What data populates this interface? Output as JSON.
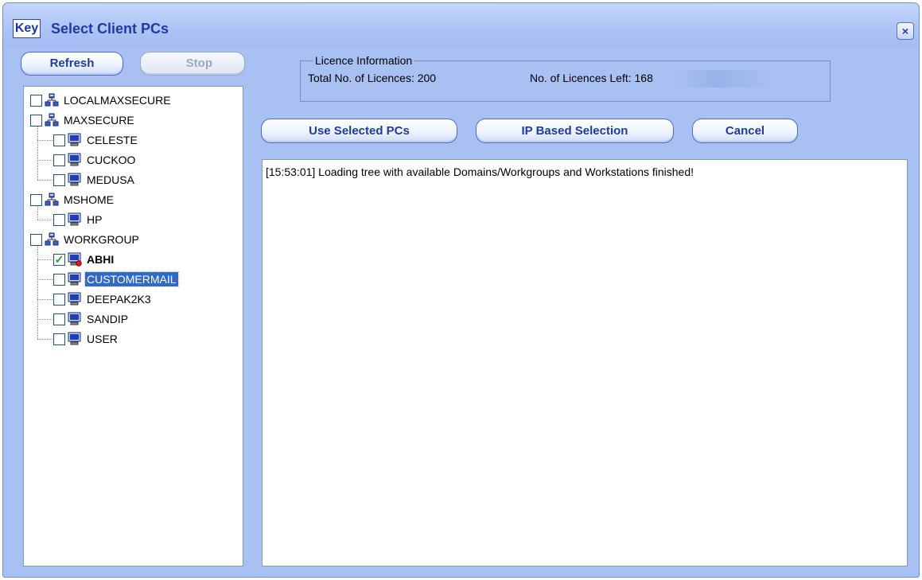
{
  "window": {
    "logo": "Key",
    "title": "Select Client PCs",
    "close_label": "×"
  },
  "toolbar": {
    "refresh_label": "Refresh",
    "stop_label": "Stop"
  },
  "licence": {
    "legend": "Licence Information",
    "total_text": "Total No. of Licences:  200",
    "left_text": "No. of Licences Left: 168"
  },
  "actions": {
    "use_selected_label": "Use Selected PCs",
    "ip_based_label": "IP Based Selection",
    "cancel_label": "Cancel"
  },
  "tree": {
    "items": [
      {
        "label": "LOCALMAXSECURE",
        "type": "workgroup",
        "level": 0,
        "checked": false
      },
      {
        "label": "MAXSECURE",
        "type": "workgroup",
        "level": 0,
        "checked": false
      },
      {
        "label": "CELESTE",
        "type": "computer",
        "level": 1,
        "checked": false
      },
      {
        "label": "CUCKOO",
        "type": "computer",
        "level": 1,
        "checked": false
      },
      {
        "label": "MEDUSA",
        "type": "computer",
        "level": 1,
        "checked": false
      },
      {
        "label": "MSHOME",
        "type": "workgroup",
        "level": 0,
        "checked": false
      },
      {
        "label": "HP",
        "type": "computer",
        "level": 1,
        "checked": false
      },
      {
        "label": "WORKGROUP",
        "type": "workgroup",
        "level": 0,
        "checked": false
      },
      {
        "label": "ABHI",
        "type": "computer",
        "level": 1,
        "checked": true,
        "bold": true,
        "badge": true
      },
      {
        "label": "CUSTOMERMAIL",
        "type": "computer",
        "level": 1,
        "checked": false,
        "selected": true
      },
      {
        "label": "DEEPAK2K3",
        "type": "computer",
        "level": 1,
        "checked": false
      },
      {
        "label": "SANDIP",
        "type": "computer",
        "level": 1,
        "checked": false
      },
      {
        "label": "USER",
        "type": "computer",
        "level": 1,
        "checked": false
      }
    ]
  },
  "log": {
    "lines": [
      "[15:53:01] Loading tree with available Domains/Workgroups and Workstations finished!"
    ]
  },
  "colors": {
    "window_bg": "#a8c0f2",
    "title_text": "#1f3aa0",
    "selection": "#316ac5",
    "check": "#21a121"
  }
}
